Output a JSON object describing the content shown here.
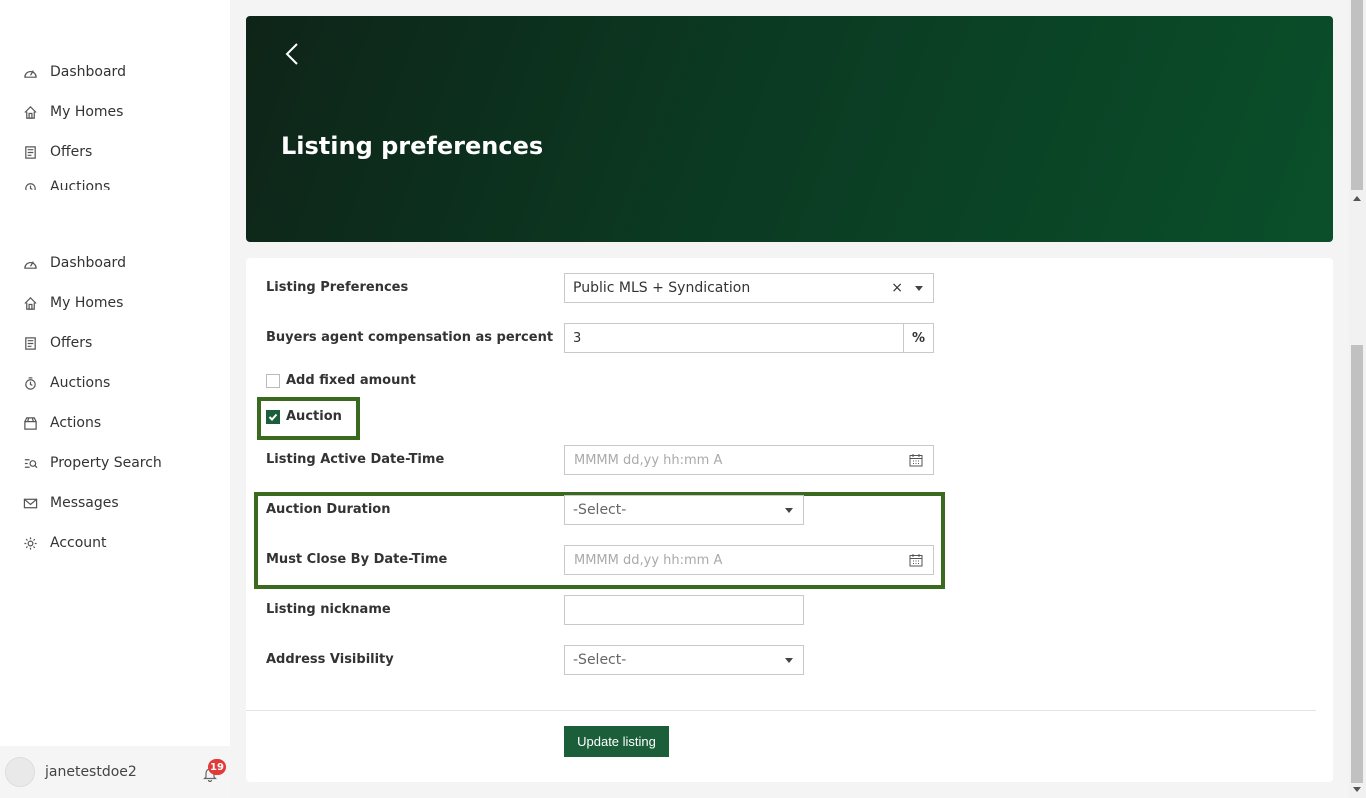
{
  "sidebar": {
    "top_items": [
      {
        "label": "Dashboard",
        "icon": "dashboard-icon"
      },
      {
        "label": "My Homes",
        "icon": "home-icon"
      },
      {
        "label": "Offers",
        "icon": "offers-icon"
      },
      {
        "label": "Auctions",
        "icon": "auctions-icon"
      }
    ],
    "items": [
      {
        "label": "Dashboard",
        "icon": "dashboard-icon"
      },
      {
        "label": "My Homes",
        "icon": "home-icon"
      },
      {
        "label": "Offers",
        "icon": "offers-icon"
      },
      {
        "label": "Auctions",
        "icon": "auctions-icon"
      },
      {
        "label": "Actions",
        "icon": "actions-icon"
      },
      {
        "label": "Property Search",
        "icon": "search-icon"
      },
      {
        "label": "Messages",
        "icon": "mail-icon"
      },
      {
        "label": "Account",
        "icon": "gear-icon"
      }
    ],
    "user": {
      "name": "janetestdoe2",
      "notifications": "19"
    }
  },
  "header": {
    "title": "Listing preferences"
  },
  "form": {
    "listing_preferences": {
      "label": "Listing Preferences",
      "value": "Public MLS + Syndication",
      "clear": "×"
    },
    "compensation": {
      "label": "Buyers agent compensation as percent",
      "value": "3",
      "suffix": "%"
    },
    "add_fixed_amount": {
      "label": "Add fixed amount",
      "checked": false
    },
    "auction": {
      "label": "Auction",
      "checked": true
    },
    "listing_active": {
      "label": "Listing Active Date-Time",
      "placeholder": "MMMM dd,yy hh:mm A"
    },
    "auction_duration": {
      "label": "Auction Duration",
      "value": "-Select-"
    },
    "must_close": {
      "label": "Must Close By Date-Time",
      "placeholder": "MMMM dd,yy hh:mm A"
    },
    "nickname": {
      "label": "Listing nickname",
      "value": ""
    },
    "address_visibility": {
      "label": "Address Visibility",
      "value": "-Select-"
    },
    "submit_label": "Update listing"
  },
  "colors": {
    "accent": "#1a5f3a",
    "highlight": "#3a6a1f",
    "banner_start": "#0e2418",
    "banner_end": "#0a4f2a",
    "badge": "#e23a3a"
  }
}
